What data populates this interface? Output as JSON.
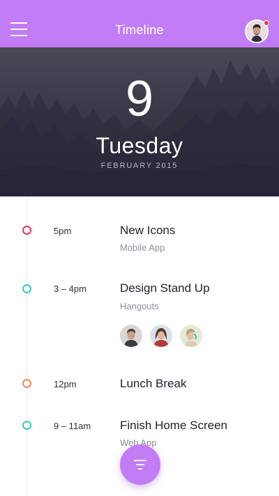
{
  "header": {
    "title": "Timeline",
    "menu_icon": "hamburger-menu-icon",
    "avatar": "user-avatar",
    "notification_color": "#f2334d"
  },
  "hero": {
    "day_number": "9",
    "day_name": "Tuesday",
    "month_year": "FEBRUARY 2015"
  },
  "events": [
    {
      "time": "5pm",
      "title": "New Icons",
      "subtitle": "Mobile App",
      "color": "#e8325a"
    },
    {
      "time": "3 – 4pm",
      "title": "Design Stand Up",
      "subtitle": "Hangouts",
      "color": "#3cc6b9",
      "attendees": [
        "attendee-avatar-1",
        "attendee-avatar-2",
        "attendee-avatar-3"
      ]
    },
    {
      "time": "12pm",
      "title": "Lunch Break",
      "subtitle": "",
      "color": "#f0845c"
    },
    {
      "time": "9 – 11am",
      "title": "Finish Home Screen",
      "subtitle": "Web App",
      "color": "#3cc6b9"
    }
  ],
  "fab": {
    "icon": "filter-icon"
  },
  "colors": {
    "accent": "#c27cf5"
  }
}
